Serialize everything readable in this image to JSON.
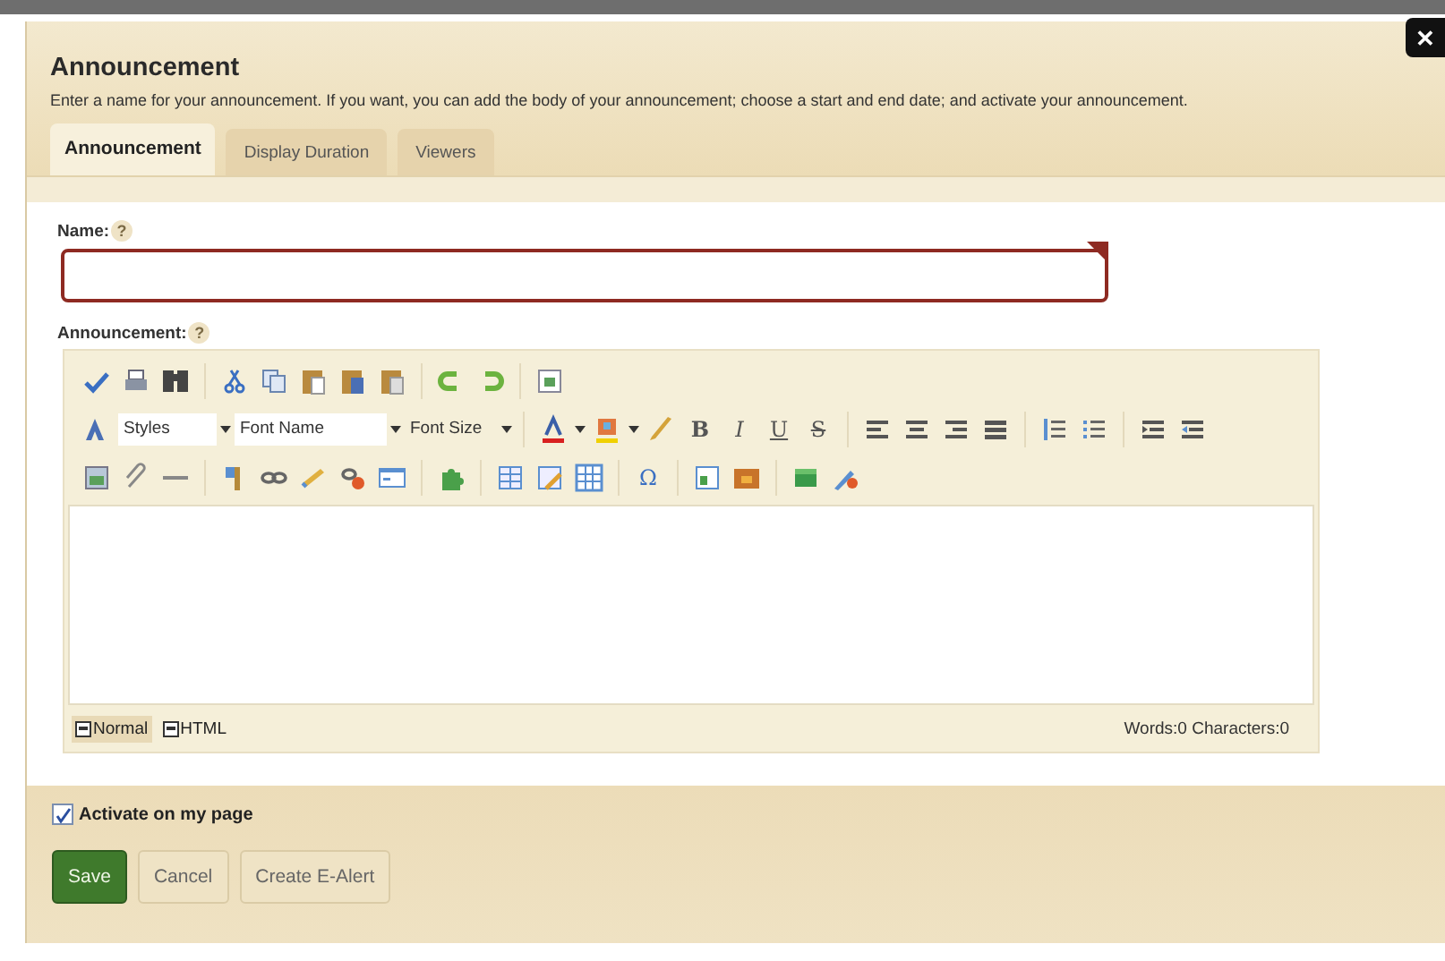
{
  "dialog": {
    "title": "Announcement",
    "description": "Enter a name for your announcement. If you want, you can add the body of your announcement; choose a start and end date; and activate your announcement.",
    "close": "✕"
  },
  "tabs": [
    {
      "label": "Announcement",
      "selected": true
    },
    {
      "label": "Display Duration",
      "selected": false
    },
    {
      "label": "Viewers",
      "selected": false
    }
  ],
  "name_field": {
    "label": "Name:",
    "help": "?",
    "required": true
  },
  "editor": {
    "label": "Announcement:",
    "help": "?",
    "dropdowns": [
      "Styles",
      "Font Name",
      "Font Size"
    ],
    "format_buttons": [
      "B",
      "I",
      "U",
      "S"
    ],
    "symbol_button": "Ω",
    "modes": [
      {
        "label": "Normal",
        "selected": true
      },
      {
        "label": "HTML",
        "selected": false
      }
    ],
    "counts": "Words:0 Characters:0"
  },
  "activate": {
    "label": "Activate on my page",
    "checked": true
  },
  "buttons": [
    {
      "label": "Save",
      "kind": "primary"
    },
    {
      "label": "Cancel",
      "kind": "secondary"
    },
    {
      "label": "Create E-Alert",
      "kind": "secondary"
    }
  ]
}
